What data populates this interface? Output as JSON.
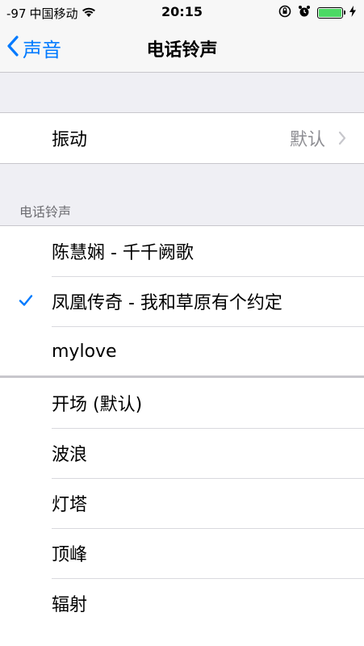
{
  "status_bar": {
    "signal": "-97",
    "carrier": "中国移动",
    "time": "20:15"
  },
  "nav": {
    "back_label": "声音",
    "title": "电话铃声"
  },
  "vibration": {
    "label": "振动",
    "value": "默认"
  },
  "ringtone_section": {
    "header": "电话铃声",
    "custom": [
      {
        "label": "陈慧娴 - 千千阙歌",
        "selected": false
      },
      {
        "label": "凤凰传奇 - 我和草原有个约定",
        "selected": true
      },
      {
        "label": "mylove",
        "selected": false
      }
    ],
    "builtin": [
      {
        "label": "开场 (默认)"
      },
      {
        "label": "波浪"
      },
      {
        "label": "灯塔"
      },
      {
        "label": "顶峰"
      },
      {
        "label": "辐射"
      }
    ]
  },
  "colors": {
    "accent": "#007aff",
    "background": "#efeff4",
    "battery": "#4cd964"
  }
}
